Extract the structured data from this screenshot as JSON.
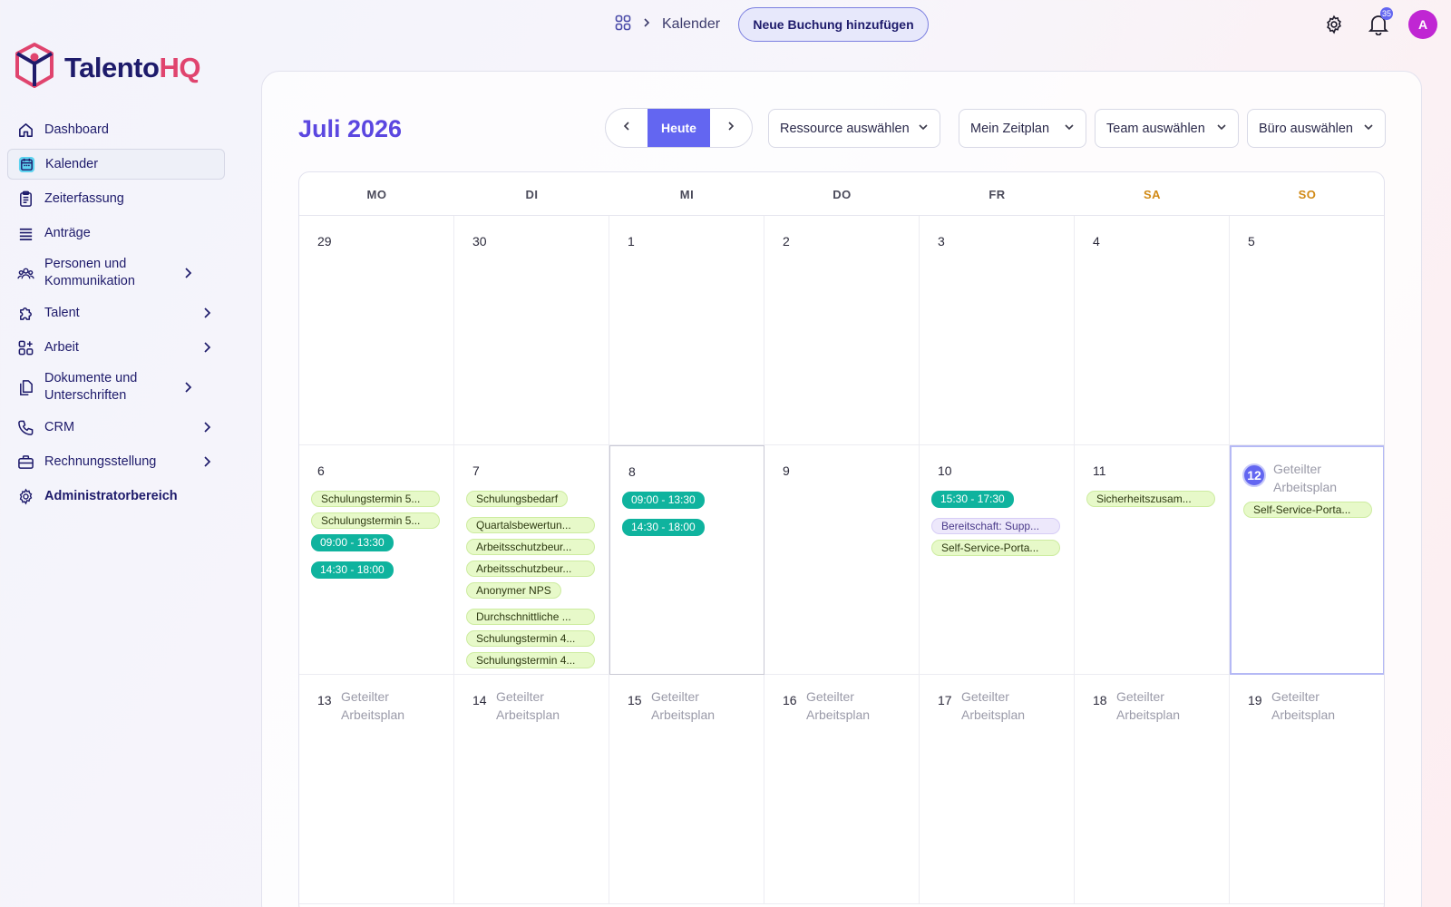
{
  "brand": {
    "name_part1": "Talento",
    "name_part2": "HQ"
  },
  "sidebar": {
    "items": [
      {
        "label": "Dashboard",
        "icon": "home-icon",
        "active": false,
        "chevron": false
      },
      {
        "label": "Kalender",
        "icon": "calendar-icon",
        "active": true,
        "chevron": false
      },
      {
        "label": "Zeiterfassung",
        "icon": "clipboard-icon",
        "active": false,
        "chevron": false
      },
      {
        "label": "Anträge",
        "icon": "list-icon",
        "active": false,
        "chevron": false
      },
      {
        "label": "Personen und Kommunikation",
        "icon": "people-icon",
        "active": false,
        "chevron": true
      },
      {
        "label": "Talent",
        "icon": "puzzle-icon",
        "active": false,
        "chevron": true
      },
      {
        "label": "Arbeit",
        "icon": "apps-icon",
        "active": false,
        "chevron": true
      },
      {
        "label": "Dokumente und Unterschriften",
        "icon": "documents-icon",
        "active": false,
        "chevron": true
      },
      {
        "label": "CRM",
        "icon": "phone-icon",
        "active": false,
        "chevron": true
      },
      {
        "label": "Rechnungsstellung",
        "icon": "briefcase-icon",
        "active": false,
        "chevron": true
      },
      {
        "label": "Administratorbereich",
        "icon": "gear-icon",
        "active": false,
        "chevron": false
      }
    ]
  },
  "topbar": {
    "breadcrumb": "Kalender",
    "add_button": "Neue Buchung hinzufügen",
    "notification_count": "35",
    "avatar_initial": "A"
  },
  "calendar": {
    "month_title": "Juli 2026",
    "today_label": "Heute",
    "filters": [
      "Ressource auswählen",
      "Mein Zeitplan",
      "Team auswählen",
      "Büro auswählen"
    ],
    "weekdays": [
      "MO",
      "DI",
      "MI",
      "DO",
      "FR",
      "SA",
      "SO"
    ],
    "weeks": [
      [
        {
          "day": "29"
        },
        {
          "day": "30"
        },
        {
          "day": "1"
        },
        {
          "day": "2"
        },
        {
          "day": "3"
        },
        {
          "day": "4"
        },
        {
          "day": "5"
        }
      ],
      [
        {
          "day": "6",
          "events": [
            {
              "label": "Schulungstermin 5...",
              "style": "green"
            },
            {
              "label": "Schulungstermin 5...",
              "style": "green"
            },
            {
              "label": "09:00 - 13:30",
              "style": "teal"
            },
            {
              "label": "14:30 - 18:00",
              "style": "teal"
            }
          ]
        },
        {
          "day": "7",
          "events": [
            {
              "label": "Schulungsbedarf",
              "style": "green-short"
            },
            {
              "label": "Quartalsbewertun...",
              "style": "green"
            },
            {
              "label": "Arbeitsschutzbeur...",
              "style": "green"
            },
            {
              "label": "Arbeitsschutzbeur...",
              "style": "green"
            },
            {
              "label": "Anonymer NPS",
              "style": "green-short"
            },
            {
              "label": "Durchschnittliche ...",
              "style": "green"
            },
            {
              "label": "Schulungstermin 4...",
              "style": "green"
            },
            {
              "label": "Schulungstermin 4...",
              "style": "green"
            }
          ]
        },
        {
          "day": "8",
          "selected": true,
          "events": [
            {
              "label": "09:00 - 13:30",
              "style": "teal"
            },
            {
              "label": "14:30 - 18:00",
              "style": "teal"
            }
          ]
        },
        {
          "day": "9"
        },
        {
          "day": "10",
          "events": [
            {
              "label": "15:30 - 17:30",
              "style": "teal"
            },
            {
              "label": "Bereitschaft: Supp...",
              "style": "lavender"
            },
            {
              "label": "Self-Service-Porta...",
              "style": "green"
            }
          ]
        },
        {
          "day": "11",
          "events": [
            {
              "label": "Sicherheitszusam...",
              "style": "green"
            }
          ]
        },
        {
          "day": "12",
          "today": true,
          "note": "Geteilter Arbeitsplan",
          "events": [
            {
              "label": "Self-Service-Porta...",
              "style": "green"
            }
          ]
        }
      ],
      [
        {
          "day": "13",
          "note": "Geteilter Arbeitsplan"
        },
        {
          "day": "14",
          "note": "Geteilter Arbeitsplan"
        },
        {
          "day": "15",
          "note": "Geteilter Arbeitsplan"
        },
        {
          "day": "16",
          "note": "Geteilter Arbeitsplan"
        },
        {
          "day": "17",
          "note": "Geteilter Arbeitsplan"
        },
        {
          "day": "18",
          "note": "Geteilter Arbeitsplan"
        },
        {
          "day": "19",
          "note": "Geteilter Arbeitsplan"
        }
      ]
    ]
  },
  "colors": {
    "accent": "#6366f1",
    "title": "#5b47e0",
    "teal_event": "#0fb39e",
    "green_event": "#e7f9c9",
    "lavender_event": "#ede8fb",
    "weekend": "#d18a16",
    "brand_pink": "#e0446e"
  }
}
